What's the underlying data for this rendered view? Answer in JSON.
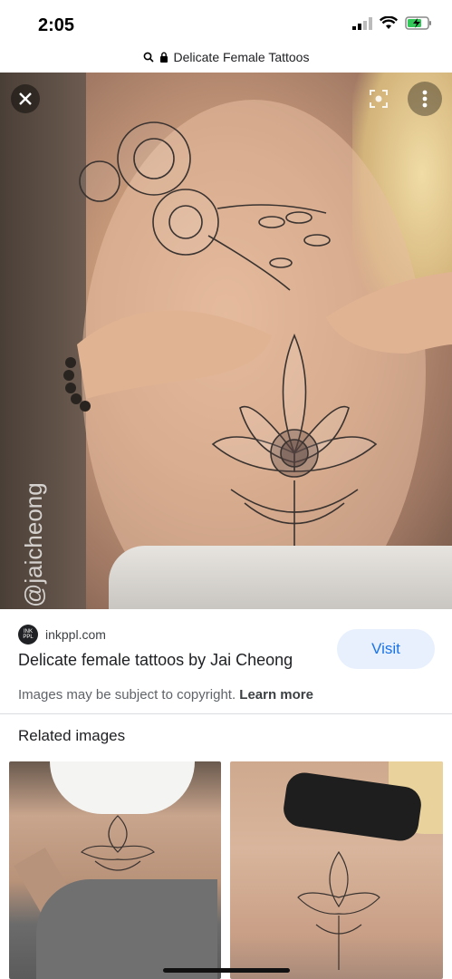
{
  "status_bar": {
    "time": "2:05"
  },
  "url_bar": {
    "title": "Delicate Female Tattoos"
  },
  "image": {
    "watermark": "@jaicheong"
  },
  "result": {
    "favicon_text": "INK PPL",
    "domain": "inkppl.com",
    "title": "Delicate female tattoos by Jai Cheong",
    "visit_label": "Visit",
    "copyright_text": "Images may be subject to copyright.",
    "learn_more_label": "Learn more"
  },
  "related": {
    "heading": "Related images"
  },
  "colors": {
    "accent": "#1a73e8",
    "visit_bg": "#e8f0fe"
  },
  "icons": [
    "search-icon",
    "lock-icon",
    "close-icon",
    "lens-icon",
    "more-vert-icon",
    "signal-icon",
    "wifi-icon",
    "battery-icon"
  ]
}
